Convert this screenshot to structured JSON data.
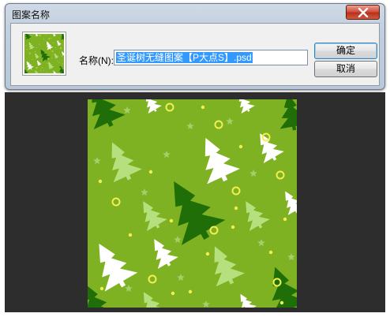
{
  "dialog": {
    "title": "图案名称",
    "name_label": "名称(N):",
    "name_value": "圣诞树无缝图案【P大点S】.psd",
    "ok_label": "确定",
    "cancel_label": "取消"
  },
  "icons": {
    "close": "close-icon",
    "trees": "christmas-tree-icon",
    "stars": "star-icon",
    "rings": "ring-icon"
  },
  "colors": {
    "pattern_green": "#7fb223",
    "tree_dark": "#1f6e08",
    "tree_light": "#b6e07e",
    "tree_white": "#ffffff",
    "star": "#a6cf6b",
    "ring": "#f3ef4e",
    "backdrop": "#2d2d2d",
    "selection": "#3399ff"
  }
}
